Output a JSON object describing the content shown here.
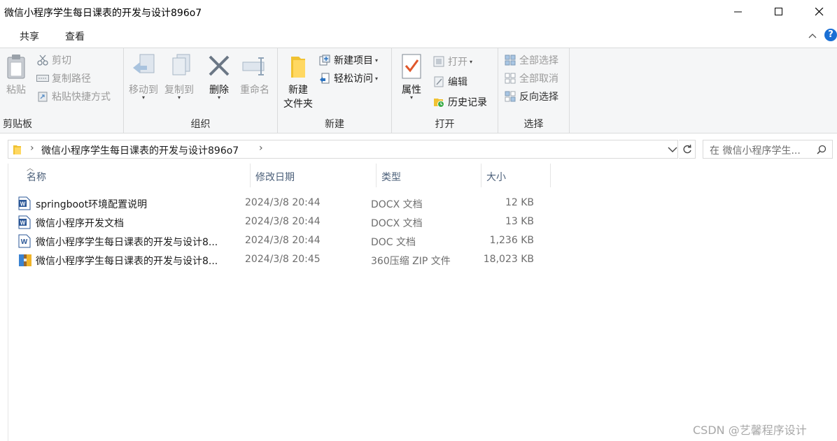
{
  "window": {
    "title": "微信小程序学生每日课表的开发与设计896o7"
  },
  "ribbon_tabs": {
    "share": "共享",
    "view": "查看"
  },
  "ribbon": {
    "clipboard": {
      "paste": "粘贴",
      "cut": "剪切",
      "copy_path": "复制路径",
      "paste_shortcut": "粘贴快捷方式",
      "label": "剪贴板"
    },
    "organize": {
      "move_to": "移动到",
      "copy_to": "复制到",
      "delete": "删除",
      "rename": "重命名",
      "label": "组织"
    },
    "new": {
      "new_folder_line1": "新建",
      "new_folder_line2": "文件夹",
      "new_item": "新建项目",
      "easy_access": "轻松访问",
      "label": "新建"
    },
    "open": {
      "properties": "属性",
      "open": "打开",
      "edit": "编辑",
      "history": "历史记录",
      "label": "打开"
    },
    "select": {
      "select_all": "全部选择",
      "select_none": "全部取消",
      "invert": "反向选择",
      "label": "选择"
    }
  },
  "address": {
    "path": "微信小程序学生每日课表的开发与设计896o7",
    "search_placeholder": "在 微信小程序学生..."
  },
  "columns": {
    "name": "名称",
    "date": "修改日期",
    "type": "类型",
    "size": "大小"
  },
  "files": [
    {
      "name": "springboot环境配置说明",
      "date": "2024/3/8 20:44",
      "type": "DOCX 文档",
      "size": "12 KB",
      "icon": "word-doc-icon"
    },
    {
      "name": "微信小程序开发文档",
      "date": "2024/3/8 20:44",
      "type": "DOCX 文档",
      "size": "13 KB",
      "icon": "word-doc-icon"
    },
    {
      "name": "微信小程序学生每日课表的开发与设计8...",
      "date": "2024/3/8 20:44",
      "type": "DOC 文档",
      "size": "1,236 KB",
      "icon": "word-doc-old-icon"
    },
    {
      "name": "微信小程序学生每日课表的开发与设计8...",
      "date": "2024/3/8 20:45",
      "type": "360压缩 ZIP 文件",
      "size": "18,023 KB",
      "icon": "zip-archive-icon"
    }
  ],
  "watermark": "CSDN @艺馨程序设计",
  "colors": {
    "accent": "#1a6fd4",
    "ribbon_bg": "#f5f6f7",
    "header_text": "#4c607a"
  }
}
